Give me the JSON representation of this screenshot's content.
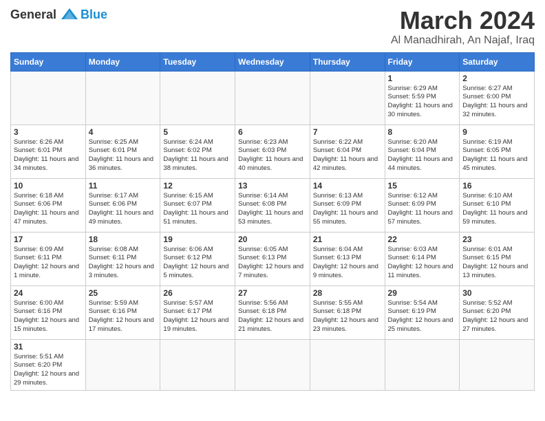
{
  "header": {
    "logo_general": "General",
    "logo_blue": "Blue",
    "month_title": "March 2024",
    "location": "Al Manadhirah, An Najaf, Iraq"
  },
  "weekdays": [
    "Sunday",
    "Monday",
    "Tuesday",
    "Wednesday",
    "Thursday",
    "Friday",
    "Saturday"
  ],
  "weeks": [
    [
      {
        "day": "",
        "info": ""
      },
      {
        "day": "",
        "info": ""
      },
      {
        "day": "",
        "info": ""
      },
      {
        "day": "",
        "info": ""
      },
      {
        "day": "",
        "info": ""
      },
      {
        "day": "1",
        "info": "Sunrise: 6:29 AM\nSunset: 5:59 PM\nDaylight: 11 hours\nand 30 minutes."
      },
      {
        "day": "2",
        "info": "Sunrise: 6:27 AM\nSunset: 6:00 PM\nDaylight: 11 hours\nand 32 minutes."
      }
    ],
    [
      {
        "day": "3",
        "info": "Sunrise: 6:26 AM\nSunset: 6:01 PM\nDaylight: 11 hours\nand 34 minutes."
      },
      {
        "day": "4",
        "info": "Sunrise: 6:25 AM\nSunset: 6:01 PM\nDaylight: 11 hours\nand 36 minutes."
      },
      {
        "day": "5",
        "info": "Sunrise: 6:24 AM\nSunset: 6:02 PM\nDaylight: 11 hours\nand 38 minutes."
      },
      {
        "day": "6",
        "info": "Sunrise: 6:23 AM\nSunset: 6:03 PM\nDaylight: 11 hours\nand 40 minutes."
      },
      {
        "day": "7",
        "info": "Sunrise: 6:22 AM\nSunset: 6:04 PM\nDaylight: 11 hours\nand 42 minutes."
      },
      {
        "day": "8",
        "info": "Sunrise: 6:20 AM\nSunset: 6:04 PM\nDaylight: 11 hours\nand 44 minutes."
      },
      {
        "day": "9",
        "info": "Sunrise: 6:19 AM\nSunset: 6:05 PM\nDaylight: 11 hours\nand 45 minutes."
      }
    ],
    [
      {
        "day": "10",
        "info": "Sunrise: 6:18 AM\nSunset: 6:06 PM\nDaylight: 11 hours\nand 47 minutes."
      },
      {
        "day": "11",
        "info": "Sunrise: 6:17 AM\nSunset: 6:06 PM\nDaylight: 11 hours\nand 49 minutes."
      },
      {
        "day": "12",
        "info": "Sunrise: 6:15 AM\nSunset: 6:07 PM\nDaylight: 11 hours\nand 51 minutes."
      },
      {
        "day": "13",
        "info": "Sunrise: 6:14 AM\nSunset: 6:08 PM\nDaylight: 11 hours\nand 53 minutes."
      },
      {
        "day": "14",
        "info": "Sunrise: 6:13 AM\nSunset: 6:09 PM\nDaylight: 11 hours\nand 55 minutes."
      },
      {
        "day": "15",
        "info": "Sunrise: 6:12 AM\nSunset: 6:09 PM\nDaylight: 11 hours\nand 57 minutes."
      },
      {
        "day": "16",
        "info": "Sunrise: 6:10 AM\nSunset: 6:10 PM\nDaylight: 11 hours\nand 59 minutes."
      }
    ],
    [
      {
        "day": "17",
        "info": "Sunrise: 6:09 AM\nSunset: 6:11 PM\nDaylight: 12 hours\nand 1 minute."
      },
      {
        "day": "18",
        "info": "Sunrise: 6:08 AM\nSunset: 6:11 PM\nDaylight: 12 hours\nand 3 minutes."
      },
      {
        "day": "19",
        "info": "Sunrise: 6:06 AM\nSunset: 6:12 PM\nDaylight: 12 hours\nand 5 minutes."
      },
      {
        "day": "20",
        "info": "Sunrise: 6:05 AM\nSunset: 6:13 PM\nDaylight: 12 hours\nand 7 minutes."
      },
      {
        "day": "21",
        "info": "Sunrise: 6:04 AM\nSunset: 6:13 PM\nDaylight: 12 hours\nand 9 minutes."
      },
      {
        "day": "22",
        "info": "Sunrise: 6:03 AM\nSunset: 6:14 PM\nDaylight: 12 hours\nand 11 minutes."
      },
      {
        "day": "23",
        "info": "Sunrise: 6:01 AM\nSunset: 6:15 PM\nDaylight: 12 hours\nand 13 minutes."
      }
    ],
    [
      {
        "day": "24",
        "info": "Sunrise: 6:00 AM\nSunset: 6:16 PM\nDaylight: 12 hours\nand 15 minutes."
      },
      {
        "day": "25",
        "info": "Sunrise: 5:59 AM\nSunset: 6:16 PM\nDaylight: 12 hours\nand 17 minutes."
      },
      {
        "day": "26",
        "info": "Sunrise: 5:57 AM\nSunset: 6:17 PM\nDaylight: 12 hours\nand 19 minutes."
      },
      {
        "day": "27",
        "info": "Sunrise: 5:56 AM\nSunset: 6:18 PM\nDaylight: 12 hours\nand 21 minutes."
      },
      {
        "day": "28",
        "info": "Sunrise: 5:55 AM\nSunset: 6:18 PM\nDaylight: 12 hours\nand 23 minutes."
      },
      {
        "day": "29",
        "info": "Sunrise: 5:54 AM\nSunset: 6:19 PM\nDaylight: 12 hours\nand 25 minutes."
      },
      {
        "day": "30",
        "info": "Sunrise: 5:52 AM\nSunset: 6:20 PM\nDaylight: 12 hours\nand 27 minutes."
      }
    ],
    [
      {
        "day": "31",
        "info": "Sunrise: 5:51 AM\nSunset: 6:20 PM\nDaylight: 12 hours\nand 29 minutes."
      },
      {
        "day": "",
        "info": ""
      },
      {
        "day": "",
        "info": ""
      },
      {
        "day": "",
        "info": ""
      },
      {
        "day": "",
        "info": ""
      },
      {
        "day": "",
        "info": ""
      },
      {
        "day": "",
        "info": ""
      }
    ]
  ]
}
